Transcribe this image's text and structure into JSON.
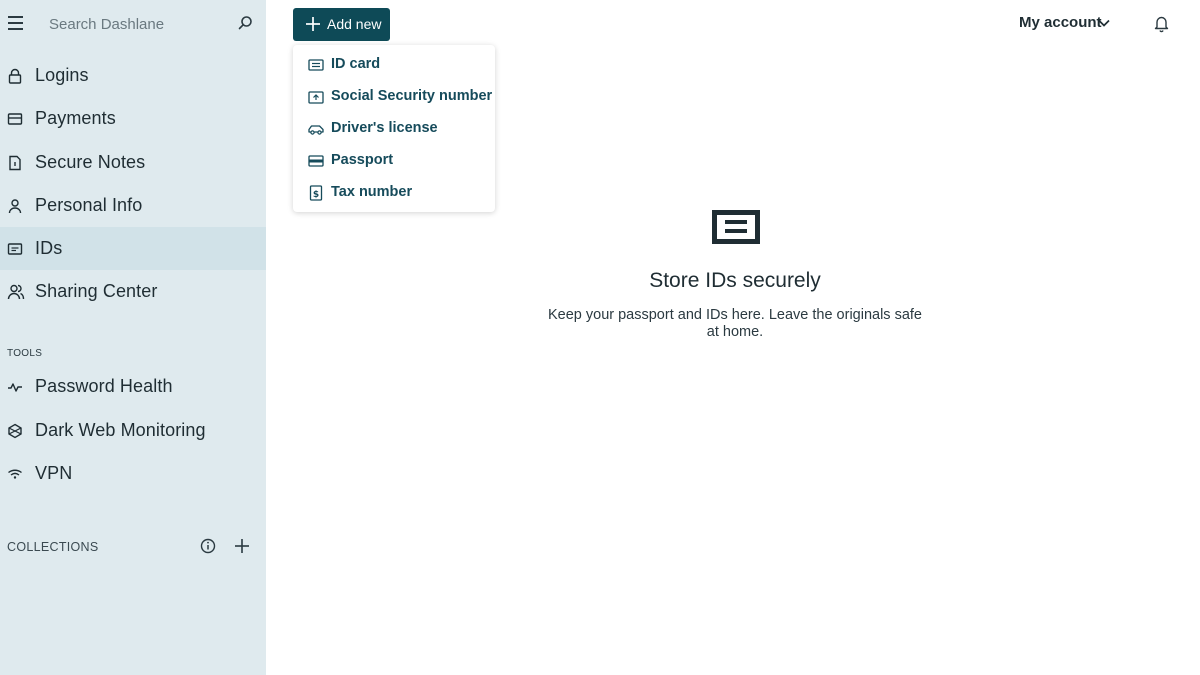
{
  "search": {
    "placeholder": "Search Dashlane"
  },
  "sidebar": {
    "items": [
      {
        "label": "Logins",
        "icon": "lock-icon"
      },
      {
        "label": "Payments",
        "icon": "card-icon"
      },
      {
        "label": "Secure Notes",
        "icon": "note-icon"
      },
      {
        "label": "Personal Info",
        "icon": "person-icon"
      },
      {
        "label": "IDs",
        "icon": "id-icon",
        "active": true
      },
      {
        "label": "Sharing Center",
        "icon": "sharing-icon"
      }
    ],
    "tools_label": "TOOLS",
    "tools": [
      {
        "label": "Password Health",
        "icon": "pulse-icon"
      },
      {
        "label": "Dark Web Monitoring",
        "icon": "dark-web-icon"
      },
      {
        "label": "VPN",
        "icon": "wifi-icon"
      }
    ],
    "collections_label": "COLLECTIONS"
  },
  "header": {
    "add_new_label": "Add new",
    "account_label": "My account"
  },
  "dropdown": {
    "items": [
      {
        "label": "ID card",
        "icon": "id-card-icon"
      },
      {
        "label": "Social Security number",
        "icon": "social-security-icon"
      },
      {
        "label": "Driver's license",
        "icon": "car-icon"
      },
      {
        "label": "Passport",
        "icon": "passport-icon"
      },
      {
        "label": "Tax number",
        "icon": "tax-icon"
      }
    ]
  },
  "empty_state": {
    "title": "Store IDs securely",
    "description": "Keep your passport and IDs here. Leave the originals safe at home."
  },
  "colors": {
    "sidebar_bg": "#dfeaee",
    "active_bg": "#d1e2e8",
    "accent": "#0e4a57",
    "dropdown_text": "#164b5b"
  }
}
